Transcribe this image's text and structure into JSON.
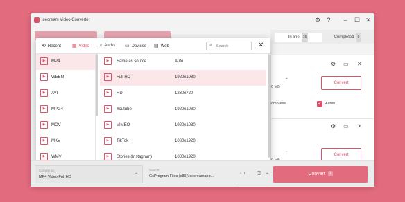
{
  "window": {
    "title": "Icecream Video Converter"
  },
  "queue_tabs": [
    {
      "label": "In line",
      "count": "15"
    },
    {
      "label": "Completed",
      "count": "9"
    }
  ],
  "bg_cards": [
    {
      "size_fragment": "0 MB",
      "convert_label": "Convert",
      "compress_label": "Compress",
      "audio_label": "Audio"
    },
    {
      "size_fragment": "0 MB",
      "convert_label": "Convert"
    }
  ],
  "dialog": {
    "tabs": [
      "Recent",
      "Video",
      "Audio",
      "Devices",
      "Web"
    ],
    "active_tab": "Video",
    "search_placeholder": "Search",
    "formats": [
      "MP4",
      "WEBM",
      "AVI",
      "MPG4",
      "MOV",
      "MKV",
      "WMV"
    ],
    "selected_format": "MP4",
    "presets": [
      {
        "name": "Same as source",
        "resolution": "Auto"
      },
      {
        "name": "Full HD",
        "resolution": "1920x1080"
      },
      {
        "name": "HD",
        "resolution": "1280x720"
      },
      {
        "name": "Youtube",
        "resolution": "1920x1080"
      },
      {
        "name": "VIMEO",
        "resolution": "1920x1080"
      },
      {
        "name": "TikTok",
        "resolution": "1080x1920"
      },
      {
        "name": "Stories (Instagram)",
        "resolution": "1080x1920"
      }
    ],
    "selected_preset": "Full HD"
  },
  "bottom": {
    "convert_as_label": "Convert as:",
    "convert_as_value": "MP4 Video Full HD",
    "source_label": "Source:",
    "source_value": "C:\\Program Files (x86)\\Icecreamapp...",
    "convert_label": "Convert",
    "convert_count": "1"
  },
  "colors": {
    "accent": "#e0506b",
    "background": "#e36b7e",
    "selected_row": "#fbe6ea"
  }
}
